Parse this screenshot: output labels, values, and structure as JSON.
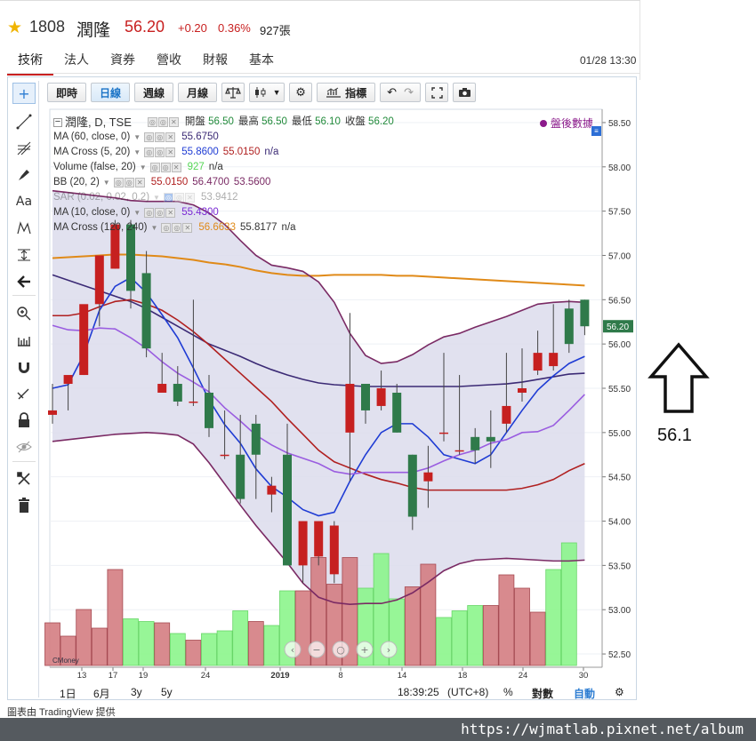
{
  "header": {
    "symbol": "1808",
    "name": "潤隆",
    "price": "56.20",
    "change": "+0.20",
    "change_pct": "0.36%",
    "volume": "927張",
    "datetime": "01/28 13:30"
  },
  "tabs": [
    "技術",
    "法人",
    "資券",
    "營收",
    "財報",
    "基本"
  ],
  "toolbar": {
    "intraday": "即時",
    "daily": "日線",
    "weekly": "週線",
    "monthly": "月線",
    "indicators": "指標"
  },
  "legend": {
    "main": "潤隆, D, TSE",
    "open_label": "開盤",
    "open": "56.50",
    "high_label": "最高",
    "high": "56.50",
    "low_label": "最低",
    "low": "56.10",
    "close_label": "收盤",
    "close": "56.20",
    "ma60_label": "MA (60, close, 0)",
    "ma60_value": "55.6750",
    "macross_label": "MA Cross (5, 20)",
    "macross_v1": "55.8600",
    "macross_v2": "55.0150",
    "macross_v3": "n/a",
    "volume_label": "Volume (false, 20)",
    "volume_v1": "927",
    "volume_v2": "n/a",
    "bb_label": "BB (20, 2)",
    "bb_v1": "55.0150",
    "bb_v2": "56.4700",
    "bb_v3": "53.5600",
    "sar_label": "SAR (0.02, 0.02, 0.2)",
    "sar_value": "53.9412",
    "ma10_label": "MA (10, close, 0)",
    "ma10_value": "55.4300",
    "macross2_label": "MA Cross (120, 240)",
    "macross2_v1": "56.6633",
    "macross2_v2": "55.8177",
    "macross2_v3": "n/a",
    "after_hours": "盤後數據"
  },
  "bottombar": {
    "range_1d": "1日",
    "range_6m": "6月",
    "range_3y": "3y",
    "range_5y": "5y",
    "time": "18:39:25",
    "tz": "(UTC+8)",
    "pct": "%",
    "log": "對數",
    "auto": "自動"
  },
  "annotation_value": "56.1",
  "footer": "圖表由 TradingView 提供",
  "watermark": "https://wjmatlab.pixnet.net/album",
  "chart_data": {
    "type": "candlestick",
    "yaxis_ticks": [
      "58.50",
      "58.00",
      "57.50",
      "57.00",
      "56.50",
      "56.00",
      "55.50",
      "55.00",
      "54.50",
      "54.00",
      "53.50",
      "53.00",
      "52.50"
    ],
    "ylim": [
      52.35,
      58.65
    ],
    "price_label": "56.20",
    "xaxis_ticks": [
      "13",
      "17",
      "19",
      "24",
      "2019",
      "8",
      "14",
      "18",
      "24",
      "30"
    ],
    "candles": [
      {
        "o": 55.25,
        "h": 55.55,
        "l": 55.1,
        "c": 55.2,
        "up": true
      },
      {
        "o": 55.55,
        "h": 55.55,
        "l": 55.25,
        "c": 55.65,
        "up": true
      },
      {
        "o": 55.65,
        "h": 56.4,
        "l": 55.65,
        "c": 56.45,
        "up": true
      },
      {
        "o": 56.45,
        "h": 57.0,
        "l": 56.2,
        "c": 57.0,
        "up": true
      },
      {
        "o": 56.85,
        "h": 57.4,
        "l": 56.85,
        "c": 57.35,
        "up": true
      },
      {
        "o": 57.35,
        "h": 57.4,
        "l": 56.4,
        "c": 56.6,
        "up": false
      },
      {
        "o": 56.8,
        "h": 57.05,
        "l": 55.85,
        "c": 55.95,
        "up": false
      },
      {
        "o": 55.55,
        "h": 55.9,
        "l": 55.5,
        "c": 55.45,
        "up": true
      },
      {
        "o": 55.55,
        "h": 55.75,
        "l": 55.3,
        "c": 55.35,
        "up": false
      },
      {
        "o": 55.35,
        "h": 56.5,
        "l": 55.3,
        "c": 55.35,
        "up": true
      },
      {
        "o": 55.45,
        "h": 55.65,
        "l": 54.95,
        "c": 55.05,
        "up": false
      },
      {
        "o": 54.75,
        "h": 55.25,
        "l": 54.7,
        "c": 54.75,
        "up": true
      },
      {
        "o": 54.75,
        "h": 55.2,
        "l": 54.2,
        "c": 54.25,
        "up": false
      },
      {
        "o": 55.1,
        "h": 55.2,
        "l": 54.25,
        "c": 54.75,
        "up": false
      },
      {
        "o": 54.4,
        "h": 54.5,
        "l": 54.1,
        "c": 54.3,
        "up": true
      },
      {
        "o": 54.75,
        "h": 55.1,
        "l": 53.5,
        "c": 53.5,
        "up": false
      },
      {
        "o": 53.5,
        "h": 54.0,
        "l": 53.3,
        "c": 54.0,
        "up": true
      },
      {
        "o": 54.0,
        "h": 54.0,
        "l": 53.5,
        "c": 53.6,
        "up": true
      },
      {
        "o": 53.95,
        "h": 54.0,
        "l": 53.3,
        "c": 53.4,
        "up": true
      },
      {
        "o": 55.0,
        "h": 56.35,
        "l": 54.45,
        "c": 55.55,
        "up": true
      },
      {
        "o": 55.55,
        "h": 55.55,
        "l": 55.1,
        "c": 55.25,
        "up": false
      },
      {
        "o": 55.3,
        "h": 55.7,
        "l": 55.25,
        "c": 55.5,
        "up": true
      },
      {
        "o": 55.45,
        "h": 55.55,
        "l": 55.0,
        "c": 55.0,
        "up": false
      },
      {
        "o": 54.75,
        "h": 54.75,
        "l": 53.9,
        "c": 54.05,
        "up": false
      },
      {
        "o": 54.55,
        "h": 54.85,
        "l": 54.15,
        "c": 54.45,
        "up": true
      },
      {
        "o": 55.0,
        "h": 55.9,
        "l": 54.9,
        "c": 55.0,
        "up": true
      },
      {
        "o": 54.8,
        "h": 55.65,
        "l": 54.75,
        "c": 54.8,
        "up": true
      },
      {
        "o": 54.95,
        "h": 55.05,
        "l": 54.65,
        "c": 54.8,
        "up": false
      },
      {
        "o": 54.95,
        "h": 55.25,
        "l": 54.6,
        "c": 54.9,
        "up": false
      },
      {
        "o": 55.1,
        "h": 55.9,
        "l": 55.0,
        "c": 55.3,
        "up": true
      },
      {
        "o": 55.5,
        "h": 55.95,
        "l": 55.35,
        "c": 55.45,
        "up": true
      },
      {
        "o": 55.7,
        "h": 56.15,
        "l": 55.65,
        "c": 55.9,
        "up": true
      },
      {
        "o": 55.9,
        "h": 56.45,
        "l": 55.7,
        "c": 55.75,
        "up": true
      },
      {
        "o": 56.0,
        "h": 56.5,
        "l": 55.9,
        "c": 56.4,
        "up": false
      },
      {
        "o": 56.5,
        "h": 56.5,
        "l": 56.1,
        "c": 56.2,
        "up": false
      }
    ],
    "volume_ratio": [
      0.32,
      0.22,
      0.42,
      0.28,
      0.72,
      0.35,
      0.33,
      0.32,
      0.24,
      0.19,
      0.24,
      0.26,
      0.41,
      0.33,
      0.3,
      0.56,
      0.56,
      0.81,
      0.61,
      0.81,
      0.58,
      0.84,
      0.5,
      0.59,
      0.76,
      0.36,
      0.41,
      0.45,
      0.45,
      0.68,
      0.58,
      0.4,
      0.72,
      0.92
    ],
    "volume_up": [
      false,
      false,
      false,
      false,
      false,
      true,
      true,
      false,
      true,
      false,
      true,
      true,
      true,
      false,
      true,
      true,
      false,
      false,
      false,
      false,
      true,
      true,
      true,
      false,
      false,
      true,
      true,
      true,
      false,
      false,
      false,
      false,
      true,
      true
    ],
    "series": [
      {
        "name": "MA Cross (120, 240) 56.6633",
        "color": "#e08a18",
        "values": [
          56.97,
          56.98,
          56.99,
          57.0,
          57.01,
          57.01,
          57.0,
          56.99,
          56.97,
          56.95,
          56.92,
          56.9,
          56.87,
          56.83,
          56.8,
          56.78,
          56.77,
          56.77,
          56.78,
          56.78,
          56.78,
          56.78,
          56.77,
          56.77,
          56.76,
          56.75,
          56.74,
          56.73,
          56.72,
          56.71,
          56.7,
          56.69,
          56.68,
          56.67,
          56.66
        ]
      },
      {
        "name": "MA (60, close, 0) 55.6750",
        "color": "#3b2a75",
        "values": [
          56.78,
          56.72,
          56.66,
          56.6,
          56.54,
          56.48,
          56.4,
          56.3,
          56.2,
          56.1,
          56.0,
          55.93,
          55.86,
          55.78,
          55.71,
          55.65,
          55.6,
          55.56,
          55.54,
          55.53,
          55.52,
          55.52,
          55.52,
          55.52,
          55.52,
          55.52,
          55.52,
          55.53,
          55.54,
          55.55,
          55.57,
          55.6,
          55.63,
          55.66,
          55.67
        ]
      },
      {
        "name": "MA Cross (5, 20) 55.0150",
        "color": "#b02020",
        "values": [
          56.32,
          56.32,
          56.35,
          56.42,
          56.48,
          56.5,
          56.45,
          56.38,
          56.27,
          56.14,
          55.99,
          55.83,
          55.67,
          55.51,
          55.35,
          55.16,
          54.98,
          54.8,
          54.67,
          54.6,
          54.53,
          54.47,
          54.43,
          54.38,
          54.35,
          54.35,
          54.35,
          54.35,
          54.35,
          54.35,
          54.37,
          54.41,
          54.47,
          54.57,
          54.65
        ]
      },
      {
        "name": "MA Cross (5, 20) 55.8600",
        "color": "#1f3cd4",
        "values": [
          55.5,
          55.54,
          55.88,
          56.38,
          56.65,
          56.75,
          56.58,
          56.33,
          56.07,
          55.73,
          55.37,
          55.09,
          54.88,
          54.59,
          54.39,
          54.27,
          54.13,
          54.06,
          54.1,
          54.45,
          54.75,
          55.0,
          55.1,
          55.1,
          54.95,
          54.75,
          54.7,
          54.65,
          54.75,
          55.0,
          55.25,
          55.48,
          55.64,
          55.78,
          55.86
        ]
      },
      {
        "name": "MA (10, close, 0) 55.4300",
        "color": "#9a5de0",
        "values": [
          56.21,
          56.16,
          56.15,
          56.18,
          56.17,
          56.07,
          55.95,
          55.8,
          55.67,
          55.57,
          55.46,
          55.28,
          55.13,
          54.97,
          54.86,
          54.77,
          54.71,
          54.65,
          54.56,
          54.53,
          54.55,
          54.55,
          54.55,
          54.55,
          54.6,
          54.68,
          54.75,
          54.8,
          54.88,
          54.92,
          55.0,
          55.01,
          55.08,
          55.25,
          55.43
        ]
      },
      {
        "name": "BB (20, 2) upper 56.4700",
        "color": "#7a2a64",
        "values": [
          57.73,
          57.71,
          57.69,
          57.67,
          57.65,
          57.62,
          57.61,
          57.61,
          57.61,
          57.57,
          57.48,
          57.35,
          57.17,
          57.0,
          56.89,
          56.86,
          56.82,
          56.7,
          56.47,
          56.12,
          55.87,
          55.78,
          55.8,
          55.88,
          55.99,
          56.08,
          56.12,
          56.19,
          56.25,
          56.31,
          56.38,
          56.45,
          56.47,
          56.48,
          56.47
        ]
      },
      {
        "name": "BB (20, 2) lower 53.5600",
        "color": "#7a2a64",
        "values": [
          54.9,
          54.92,
          54.94,
          54.96,
          54.98,
          54.99,
          55.0,
          54.99,
          54.97,
          54.87,
          54.66,
          54.42,
          54.18,
          53.95,
          53.74,
          53.53,
          53.3,
          53.14,
          53.08,
          53.06,
          53.07,
          53.07,
          53.11,
          53.19,
          53.31,
          53.44,
          53.52,
          53.56,
          53.57,
          53.58,
          53.57,
          53.56,
          53.55,
          53.55,
          53.56
        ]
      }
    ]
  }
}
